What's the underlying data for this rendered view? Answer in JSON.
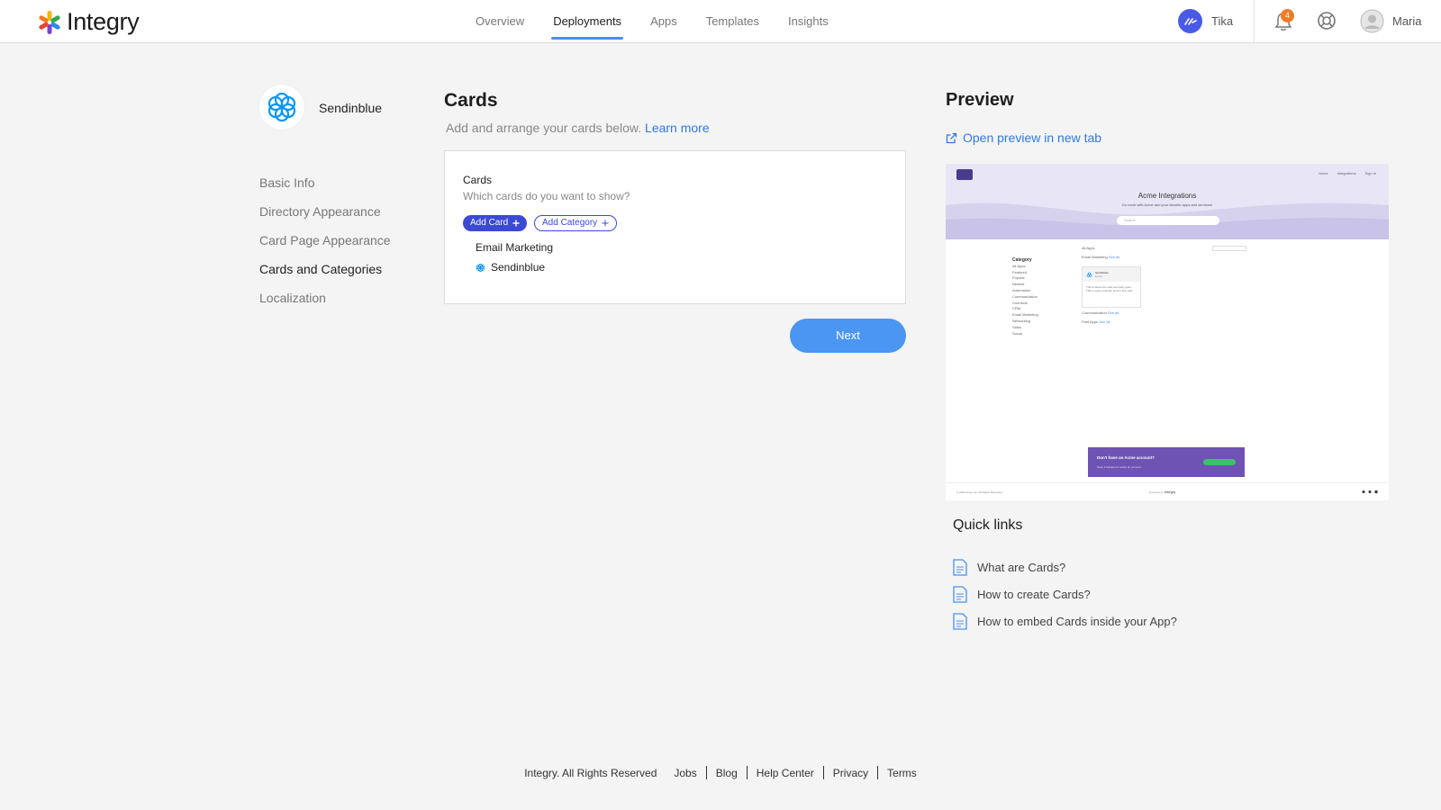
{
  "header": {
    "brand": "Integry",
    "nav": [
      {
        "label": "Overview",
        "active": false
      },
      {
        "label": "Deployments",
        "active": true
      },
      {
        "label": "Apps",
        "active": false
      },
      {
        "label": "Templates",
        "active": false
      },
      {
        "label": "Insights",
        "active": false
      }
    ],
    "tenant_name": "Tika",
    "notification_count": "4",
    "user_name": "Maria",
    "accent_color": "#4a8ff0"
  },
  "app": {
    "name": "Sendinblue",
    "logo_icon": "sendinblue-logo"
  },
  "sidebar": {
    "items": [
      {
        "label": "Basic Info",
        "active": false
      },
      {
        "label": "Directory Appearance",
        "active": false
      },
      {
        "label": "Card Page Appearance",
        "active": false
      },
      {
        "label": "Cards and Categories",
        "active": true
      },
      {
        "label": "Localization",
        "active": false
      }
    ]
  },
  "main": {
    "title": "Cards",
    "subtitle": "Add and arrange your cards below.",
    "learn_more": "Learn more",
    "box": {
      "title": "Cards",
      "subtitle": "Which cards do you want to show?",
      "add_card_label": "Add Card",
      "add_category_label": "Add Category",
      "category_name": "Email Marketing",
      "card_name": "Sendinblue"
    },
    "next_label": "Next",
    "primary_button_color": "#3b49d6"
  },
  "preview": {
    "title": "Preview",
    "open_link": "Open preview in new tab",
    "mock": {
      "nav_links": [
        "Home",
        "Integrations",
        "Sign In"
      ],
      "heading": "Acme Integrations",
      "subheading": "Do more with Acme and your favorite apps and services!",
      "search_placeholder": "Search",
      "sidebar_heading": "Category",
      "sidebar_items": [
        "All Apps",
        "Featured",
        "Popular",
        "Newest",
        "Automation",
        "Communication",
        "Connects",
        "CRM",
        "Email Marketing",
        "Networking",
        "Sales",
        "Social"
      ],
      "all_apps_label": "All Apps",
      "section_email": "Email Marketing",
      "see_all": "See all",
      "card_title": "Sendinblue",
      "card_sub": "Email",
      "card_desc": "This is where the card summary goes. This is some example text for this card.",
      "section_comm": "Communication",
      "section_paid": "Paid Apps",
      "banner_title": "Don't have an Acme account?",
      "banner_sub": "Keep it between to setup an account",
      "footer_left": "© 2020 Acme Inc. All Rights Reserved",
      "footer_center": "Integry",
      "footer_center_prefix": "Powered by"
    }
  },
  "quick_links": {
    "title": "Quick links",
    "items": [
      {
        "label": "What are Cards?"
      },
      {
        "label": "How to create Cards?"
      },
      {
        "label": "How to embed Cards inside your App?"
      }
    ]
  },
  "footer": {
    "copyright": "Integry. All Rights Reserved",
    "links": [
      "Jobs",
      "Blog",
      "Help Center",
      "Privacy",
      "Terms"
    ]
  }
}
